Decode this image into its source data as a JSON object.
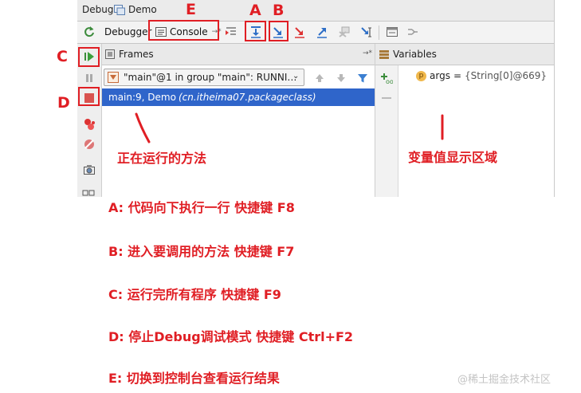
{
  "window": {
    "title": "Debug",
    "config_name": "Demo"
  },
  "toolbar": {
    "debugger_tab": "Debugger",
    "console_tab": "Console",
    "console_pin": "→*"
  },
  "frames": {
    "title": "Frames",
    "pin": "→*",
    "thread_selector": "\"main\"@1 in group \"main\": RUNNI…",
    "items": [
      {
        "method": "main:9, Demo",
        "package": "(cn.itheima07.packageclass)"
      }
    ]
  },
  "variables": {
    "title": "Variables",
    "items": [
      {
        "badge": "p",
        "name": "args",
        "eq": "=",
        "value": "{String[0]@669}"
      }
    ]
  },
  "callouts": {
    "letters": {
      "A": "A",
      "B": "B",
      "C": "C",
      "D": "D",
      "E": "E"
    },
    "frames_caption": "正在运行的方法",
    "variables_caption": "变量值显示区域"
  },
  "notes": [
    "A: 代码向下执行一行 快捷键 F8",
    "B: 进入要调用的方法 快捷键 F7",
    "C: 运行完所有程序 快捷键 F9",
    "D: 停止Debug调试模式 快捷键 Ctrl+F2",
    "E: 切换到控制台查看运行结果"
  ],
  "watermark": "@稀土掘金技术社区",
  "colors": {
    "accent_red": "#e01e24",
    "selection_blue": "#2f65ca"
  }
}
